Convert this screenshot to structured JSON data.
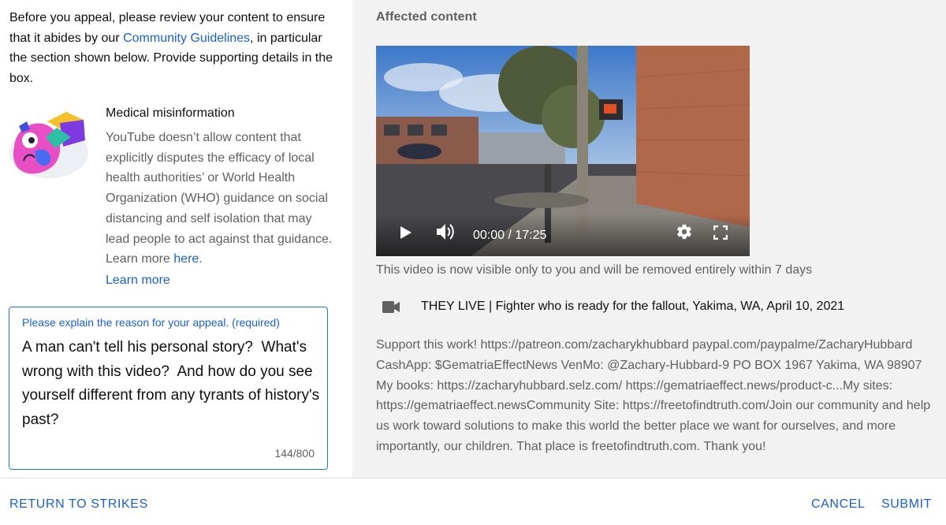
{
  "intro": {
    "before": "Before you appeal, please review your content to ensure that it abides by our ",
    "link": "Community Guidelines",
    "after": ", in particular the section shown below. Provide supporting details in the box."
  },
  "policy": {
    "title": "Medical misinformation",
    "body": "YouTube doesn’t allow content that explicitly disputes the efficacy of local health authorities’ or World Health Organization (WHO) guidance on social distancing and self isolation that may lead people to act against that guidance. Learn more ",
    "here_link": "here",
    "period": ".",
    "learn_more": "Learn more"
  },
  "appeal": {
    "label": "Please explain the reason for your appeal. (required)",
    "value": "A man can't tell his personal story?  What's wrong with this video?  And how do you see yourself different from any tyrants of history's past?",
    "counter": "144/800"
  },
  "affected": {
    "title": "Affected content",
    "player": {
      "time": "00:00 / 17:25",
      "icons": [
        "play-icon",
        "volume-icon",
        "gear-icon",
        "fullscreen-icon"
      ]
    },
    "visibility_note": "This video is now visible only to you and will be removed entirely within 7 days",
    "video_icon": "video-camera-icon",
    "video_title": "THEY LIVE | Fighter who is ready for the fallout, Yakima, WA, April 10, 2021",
    "description": "Support this work! https://patreon.com/zacharykhubbard paypal.com/paypalme/ZacharyHubbard CashApp: $GematriaEffectNews VenMo: @Zachary-Hubbard-9 PO BOX 1967 Yakima, WA 98907 My books: https://zacharyhubbard.selz.com/ https://gematriaeffect.news/product-c...My sites: https://gematriaeffect.newsCommunity Site: https://freetofindtruth.com/Join our community and help us work toward solutions to make this world the better place we want for ourselves, and more importantly, our children. That place is freetofindtruth.com. Thank you!"
  },
  "footer": {
    "return": "RETURN TO STRIKES",
    "cancel": "CANCEL",
    "submit": "SUBMIT"
  },
  "colors": {
    "link": "#1a5fd3",
    "right_panel_bg": "#f2f2f2",
    "muted_text": "#606060",
    "focus_border": "#1a73e8"
  }
}
